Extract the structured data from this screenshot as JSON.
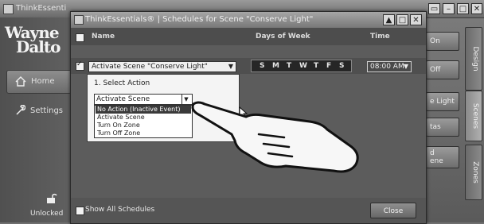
{
  "app": {
    "title": "ThinkEssenti",
    "logo_line1": "Wayne",
    "logo_line2": "Dalto",
    "nav": [
      {
        "label": "Home",
        "icon": "house-icon"
      },
      {
        "label": "Settings",
        "icon": "wrench-icon"
      }
    ],
    "lock_status": "Unlocked",
    "right_buttons": [
      "On",
      "Off",
      "e Light",
      "tas",
      "d\nene"
    ],
    "vertical_tabs": [
      "Design",
      "Scenes",
      "Zones"
    ]
  },
  "dialog": {
    "title": "ThinkEssentials® | Schedules for Scene \"Conserve Light\"",
    "columns": {
      "name": "Name",
      "days": "Days of Week",
      "time": "Time"
    },
    "row": {
      "action": "Activate Scene \"Conserve Light\"",
      "days": [
        "S",
        "M",
        "T",
        "W",
        "T",
        "F",
        "S"
      ],
      "time": "08:00 AM"
    },
    "popup": {
      "label": "1. Select Action",
      "selected": "Activate Scene",
      "options": [
        "No Action (Inactive Event)",
        "Activate Scene",
        "Turn On Zone",
        "Turn Off Zone"
      ],
      "highlighted_index": 0
    },
    "footer": {
      "show_all": "Show All Schedules",
      "close": "Close"
    }
  },
  "colors": {
    "dialog_bg": "#5c5c5c",
    "popup_bg": "#f4f4f4",
    "highlight": "#3a3a3a"
  }
}
